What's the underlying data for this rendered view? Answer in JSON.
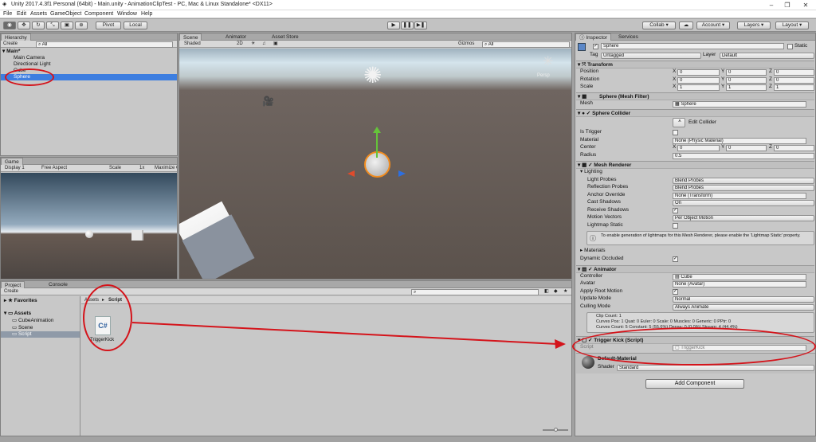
{
  "window": {
    "title": "Unity 2017.4.3f1 Personal (64bit) - Main.unity - AnimationClipTest - PC, Mac & Linux Standalone* <DX11>"
  },
  "menu": [
    "File",
    "Edit",
    "Assets",
    "GameObject",
    "Component",
    "Window",
    "Help"
  ],
  "toolbar": {
    "pivot": "Pivot",
    "local": "Local",
    "collab": "Collab",
    "account": "Account",
    "layers": "Layers",
    "layout": "Layout"
  },
  "hierarchy": {
    "tab": "Hierarchy",
    "create": "Create",
    "search_placeholder": "All",
    "scene": "Main*",
    "items": [
      "Main Camera",
      "Directional Light",
      "Cube",
      "Sphere"
    ]
  },
  "scene": {
    "tabs": [
      "Scene",
      "Animator",
      "Asset Store"
    ],
    "shading": "Shaded",
    "mode_2d": "2D",
    "gizmos": "Gizmos",
    "search_placeholder": "All",
    "persp": "Persp"
  },
  "game": {
    "tab": "Game",
    "display": "Display 1",
    "aspect": "Free Aspect",
    "scale_label": "Scale",
    "scale_value": "1x",
    "maximize": "Maximize O"
  },
  "project": {
    "tabs": [
      "Project",
      "Console"
    ],
    "create": "Create",
    "favorites": "Favorites",
    "assets": "Assets",
    "folders": [
      "CubeAnimation",
      "Scene",
      "Script"
    ],
    "breadcrumb": [
      "Assets",
      "Script"
    ],
    "file_name": "TriggerKick",
    "file_glyph": "C#"
  },
  "inspector": {
    "tabs": [
      "Inspector",
      "Services"
    ],
    "object_name": "Sphere",
    "static_label": "Static",
    "tag_label": "Tag",
    "tag_value": "Untagged",
    "layer_label": "Layer",
    "layer_value": "Default",
    "transform": {
      "title": "Transform",
      "rows": [
        {
          "label": "Position",
          "x": "0",
          "y": "0",
          "z": "0"
        },
        {
          "label": "Rotation",
          "x": "0",
          "y": "0",
          "z": "0"
        },
        {
          "label": "Scale",
          "x": "1",
          "y": "1",
          "z": "1"
        }
      ]
    },
    "mesh_filter": {
      "title": "Sphere (Mesh Filter)",
      "mesh_label": "Mesh",
      "mesh_value": "Sphere"
    },
    "collider": {
      "title": "Sphere Collider",
      "edit": "Edit Collider",
      "is_trigger": "Is Trigger",
      "material_label": "Material",
      "material_value": "None (Physic Material)",
      "center_label": "Center",
      "cx": "0",
      "cy": "0",
      "cz": "0",
      "radius_label": "Radius",
      "radius_value": "0.5"
    },
    "renderer": {
      "title": "Mesh Renderer",
      "lighting": "Lighting",
      "rows": [
        {
          "label": "Light Probes",
          "value": "Blend Probes"
        },
        {
          "label": "Reflection Probes",
          "value": "Blend Probes"
        },
        {
          "label": "Anchor Override",
          "value": "None (Transform)"
        },
        {
          "label": "Cast Shadows",
          "value": "On"
        }
      ],
      "receive_shadows": "Receive Shadows",
      "motion_label": "Motion Vectors",
      "motion_value": "Per Object Motion",
      "lightmap_static": "Lightmap Static",
      "info": "To enable generation of lightmaps for this Mesh Renderer, please enable the 'Lightmap Static' property.",
      "materials": "Materials",
      "dynamic_occluded": "Dynamic Occluded"
    },
    "animator": {
      "title": "Animator",
      "controller_label": "Controller",
      "controller_value": "Cube",
      "avatar_label": "Avatar",
      "avatar_value": "None (Avatar)",
      "root_motion": "Apply Root Motion",
      "update_label": "Update Mode",
      "update_value": "Normal",
      "culling_label": "Culling Mode",
      "culling_value": "Always Animate",
      "stats": [
        "Clip Count: 1",
        "Curves Pos: 1 Quat: 0 Euler: 0 Scale: 0 Muscles: 0 Generic: 0 PPtr: 0",
        "Curves Count: 5 Constant: 5 (55.6%) Dense: 0 (0.0%) Stream: 4 (44.4%)"
      ]
    },
    "trigger_kick": {
      "title": "Trigger Kick (Script)",
      "script_label": "Script",
      "script_value": "TriggerKick"
    },
    "material": {
      "name": "Default-Material",
      "shader_label": "Shader",
      "shader_value": "Standard"
    },
    "add_component": "Add Component"
  },
  "colors": {
    "accent": "#3d7ee0",
    "annotation": "#d4141b"
  }
}
